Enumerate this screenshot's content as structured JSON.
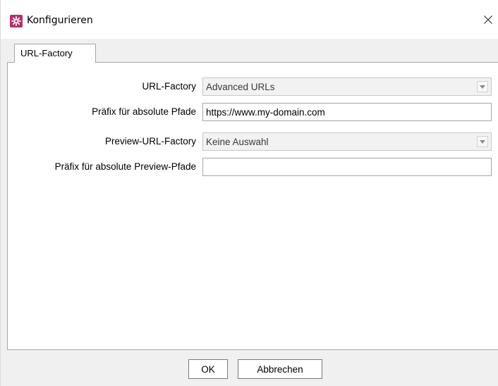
{
  "window": {
    "title": "Konfigurieren",
    "app_icon": "gear-icon",
    "close_icon": "close-icon",
    "accent_color": "#b0306a"
  },
  "tabs": [
    {
      "label": "URL-Factory",
      "selected": true
    }
  ],
  "form": {
    "url_factory": {
      "label": "URL-Factory",
      "value": "Advanced URLs"
    },
    "prefix_absolute": {
      "label": "Präfix für absolute Pfade",
      "value": "https://www.my-domain.com"
    },
    "preview_url_factory": {
      "label": "Preview-URL-Factory",
      "value": "Keine Auswahl"
    },
    "prefix_preview_absolute": {
      "label": "Präfix für absolute Preview-Pfade",
      "value": ""
    }
  },
  "buttons": {
    "ok": "OK",
    "cancel": "Abbrechen"
  }
}
